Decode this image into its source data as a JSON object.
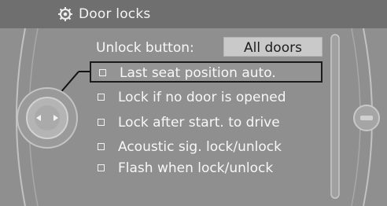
{
  "header": {
    "title": "Door locks",
    "icon": "gear-icon"
  },
  "unlock": {
    "label": "Unlock button:",
    "value": "All doors"
  },
  "options": [
    {
      "label": "Last seat position auto.",
      "checked": false,
      "selected": true
    },
    {
      "label": "Lock if no door is opened",
      "checked": false,
      "selected": false
    },
    {
      "label": "Lock after start. to drive",
      "checked": false,
      "selected": false
    },
    {
      "label": "Acoustic sig. lock/unlock",
      "checked": false,
      "selected": false
    },
    {
      "label": "Flash when lock/unlock",
      "checked": false,
      "selected": false
    }
  ],
  "controller": {
    "icon": "left-right-arrows-icon"
  }
}
